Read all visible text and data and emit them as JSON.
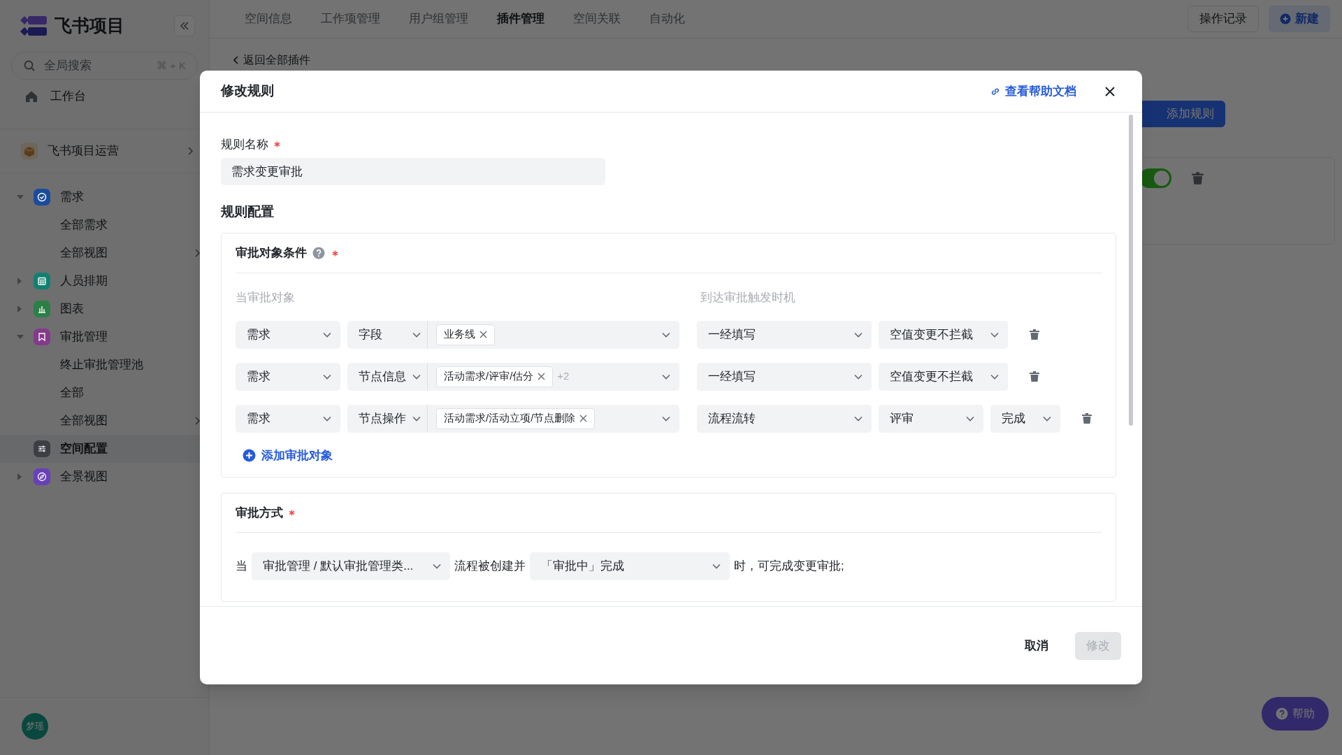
{
  "sidebar": {
    "logo_text": "飞书项目",
    "search": {
      "placeholder": "全局搜索",
      "shortcut": "⌘ + K"
    },
    "workbench": "工作台",
    "space": "飞书项目运营",
    "nav": [
      {
        "label": "需求",
        "kind": "group",
        "expanded": true,
        "selected": false,
        "color": "#1b4c9c",
        "children": [
          {
            "label": "全部需求",
            "submenu": false
          },
          {
            "label": "全部视图",
            "submenu": true
          }
        ]
      },
      {
        "label": "人员排期",
        "kind": "group",
        "expanded": false,
        "selected": false,
        "color": "#12806f"
      },
      {
        "label": "图表",
        "kind": "group",
        "expanded": false,
        "selected": false,
        "color": "#2c7f45"
      },
      {
        "label": "审批管理",
        "kind": "group",
        "expanded": true,
        "selected": false,
        "color": "#843a8b",
        "children": [
          {
            "label": "终止审批管理池",
            "submenu": false
          },
          {
            "label": "全部",
            "submenu": false
          },
          {
            "label": "全部视图",
            "submenu": true
          }
        ]
      },
      {
        "label": "空间配置",
        "kind": "link",
        "selected": true,
        "color": "#3c3e44"
      },
      {
        "label": "全景视图",
        "kind": "group",
        "expanded": false,
        "selected": false,
        "color": "#6840b8"
      }
    ],
    "user": "梦瑶"
  },
  "top_tabs": [
    {
      "label": "空间信息",
      "selected": false
    },
    {
      "label": "工作项管理",
      "selected": false
    },
    {
      "label": "用户组管理",
      "selected": false
    },
    {
      "label": "插件管理",
      "selected": true
    },
    {
      "label": "空间关联",
      "selected": false
    },
    {
      "label": "自动化",
      "selected": false
    }
  ],
  "top_actions": {
    "history": "操作记录",
    "new": "新建"
  },
  "page": {
    "back_link": "返回全部插件",
    "add_rule": "添加规则",
    "rule_enabled": true
  },
  "modal": {
    "title": "修改规则",
    "help_link": "查看帮助文档",
    "name_label": "规则名称",
    "name_value": "需求变更审批",
    "config_title": "规则配置",
    "conditions": {
      "title": "审批对象条件",
      "left_header": "当审批对象",
      "right_header": "到达审批触发时机",
      "rows": [
        {
          "object": "需求",
          "type": "字段",
          "tags": [
            "业务线"
          ],
          "triggers": [
            "一经填写",
            "空值变更不拦截"
          ]
        },
        {
          "object": "需求",
          "type": "节点信息",
          "tags": [
            "活动需求/评审/估分"
          ],
          "more": "+2",
          "triggers": [
            "一经填写",
            "空值变更不拦截"
          ]
        },
        {
          "object": "需求",
          "type": "节点操作",
          "tags": [
            "活动需求/活动立项/节点删除"
          ],
          "triggers": [
            "流程流转",
            "评审",
            "完成"
          ]
        }
      ],
      "add_label": "添加审批对象"
    },
    "method": {
      "title": "审批方式",
      "prefix": "当",
      "workflow": "审批管理 / 默认审批管理类...",
      "middle": "流程被创建并",
      "state": "「审批中」完成",
      "suffix": "时，可完成变更审批;"
    },
    "cancel": "取消",
    "submit": {
      "label": "修改",
      "disabled": true
    }
  },
  "help_button": "帮助"
}
